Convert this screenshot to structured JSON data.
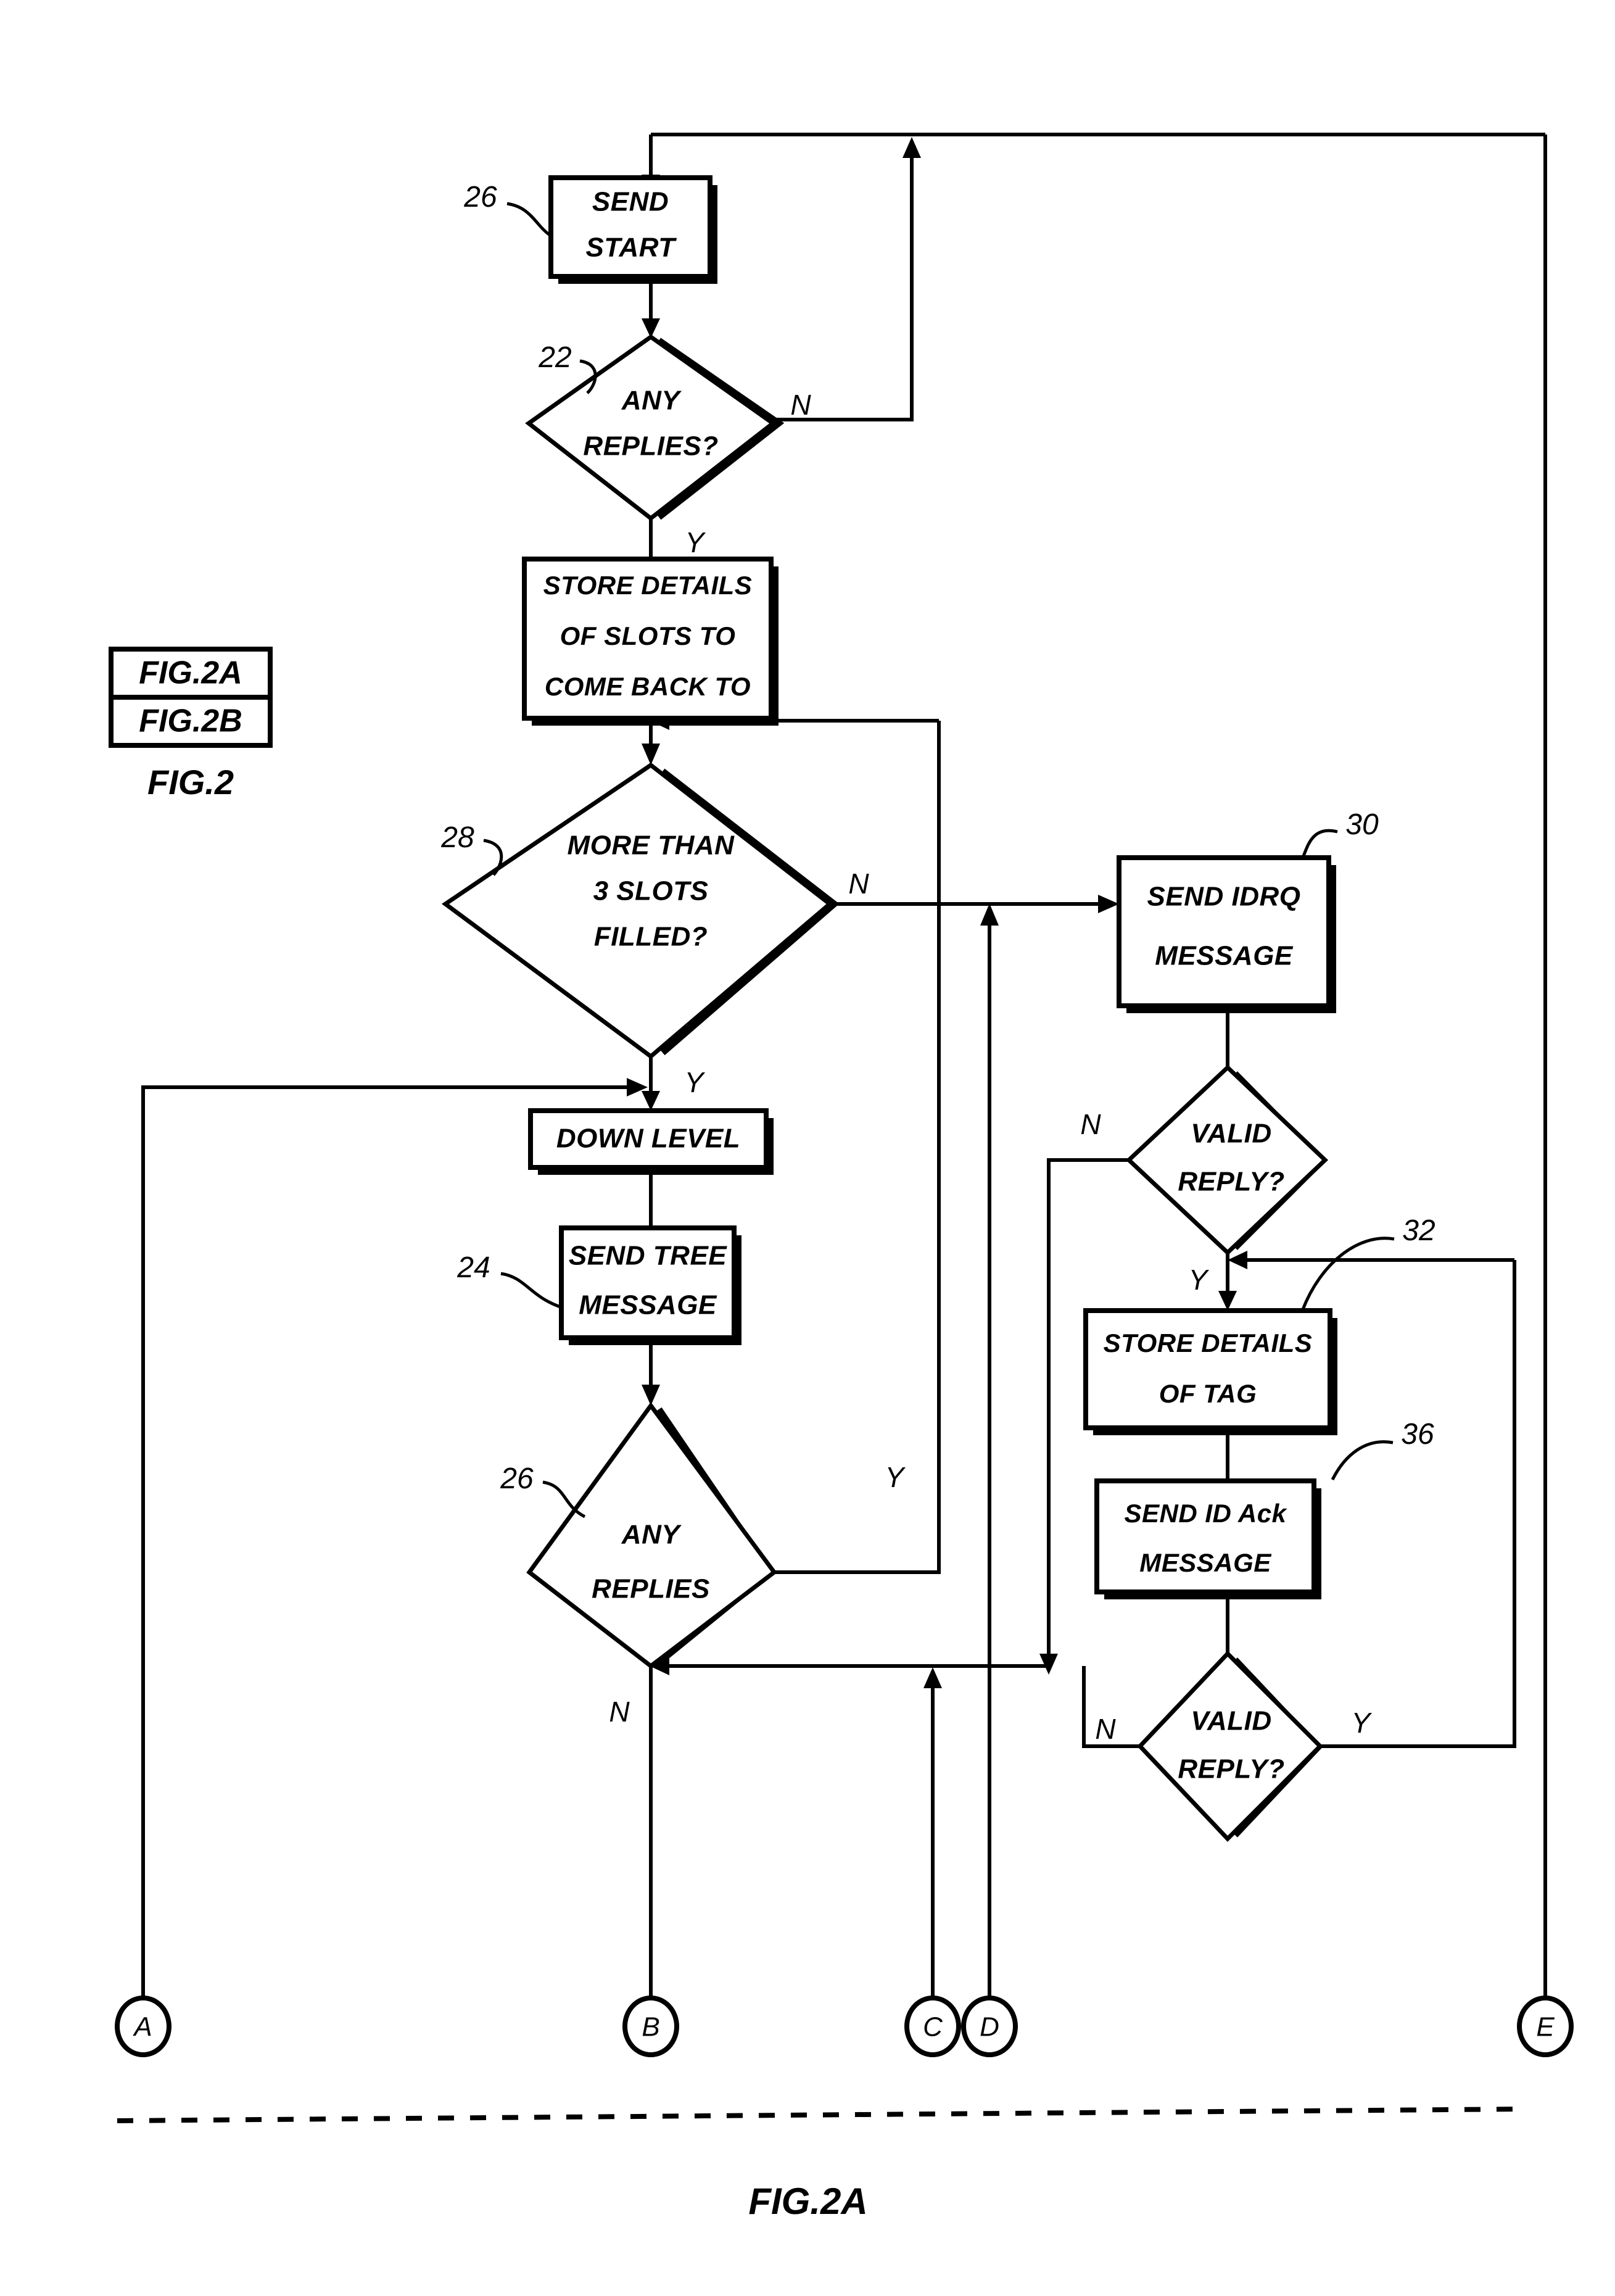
{
  "figure": {
    "key_box": {
      "rows": [
        "FIG.2A",
        "FIG.2B"
      ],
      "caption": "FIG.2"
    },
    "bottom_caption": "FIG.2A"
  },
  "nodes": [
    {
      "id": "send_start",
      "kind": "process",
      "ref": "26",
      "lines": [
        "SEND",
        "START"
      ]
    },
    {
      "id": "any_replies_q",
      "kind": "decision",
      "ref": "22",
      "lines": [
        "ANY",
        "REPLIES?"
      ]
    },
    {
      "id": "store_slots",
      "kind": "process",
      "ref": "",
      "lines": [
        "STORE DETAILS",
        "OF SLOTS TO",
        "COME BACK TO"
      ]
    },
    {
      "id": "more_than_3",
      "kind": "decision",
      "ref": "28",
      "lines": [
        "MORE THAN",
        "3 SLOTS",
        "FILLED?"
      ]
    },
    {
      "id": "down_level",
      "kind": "process",
      "ref": "",
      "lines": [
        "DOWN LEVEL"
      ]
    },
    {
      "id": "send_tree",
      "kind": "process",
      "ref": "24",
      "lines": [
        "SEND TREE",
        "MESSAGE"
      ]
    },
    {
      "id": "any_replies_2",
      "kind": "decision",
      "ref": "26",
      "lines": [
        "ANY",
        "REPLIES"
      ]
    },
    {
      "id": "send_idrq",
      "kind": "process",
      "ref": "30",
      "lines": [
        "SEND IDRQ",
        "MESSAGE"
      ]
    },
    {
      "id": "valid_reply_1",
      "kind": "decision",
      "ref": "",
      "lines": [
        "VALID",
        "REPLY?"
      ]
    },
    {
      "id": "store_tag",
      "kind": "process",
      "ref": "32",
      "lines": [
        "STORE DETAILS",
        "OF TAG"
      ]
    },
    {
      "id": "send_id_ack",
      "kind": "process",
      "ref": "36",
      "lines": [
        "SEND ID Ack",
        "MESSAGE"
      ]
    },
    {
      "id": "valid_reply_2",
      "kind": "decision",
      "ref": "",
      "lines": [
        "VALID",
        "REPLY?"
      ]
    }
  ],
  "branch_labels": {
    "any_replies_q_no": "N",
    "any_replies_q_yes": "Y",
    "more_than_3_no": "N",
    "more_than_3_yes": "Y",
    "any_replies_2_yes": "Y",
    "any_replies_2_no": "N",
    "valid_reply_1_no": "N",
    "valid_reply_1_yes": "Y",
    "valid_reply_2_no": "N",
    "valid_reply_2_yes": "Y"
  },
  "connectors": [
    {
      "id": "conn_a",
      "letter": "A"
    },
    {
      "id": "conn_b",
      "letter": "B"
    },
    {
      "id": "conn_c",
      "letter": "C"
    },
    {
      "id": "conn_d",
      "letter": "D"
    },
    {
      "id": "conn_e",
      "letter": "E"
    }
  ],
  "reference_numerals": [
    "26",
    "22",
    "28",
    "24",
    "26",
    "30",
    "32",
    "36"
  ],
  "colors": {
    "ink": "#000000",
    "paper": "#ffffff"
  }
}
